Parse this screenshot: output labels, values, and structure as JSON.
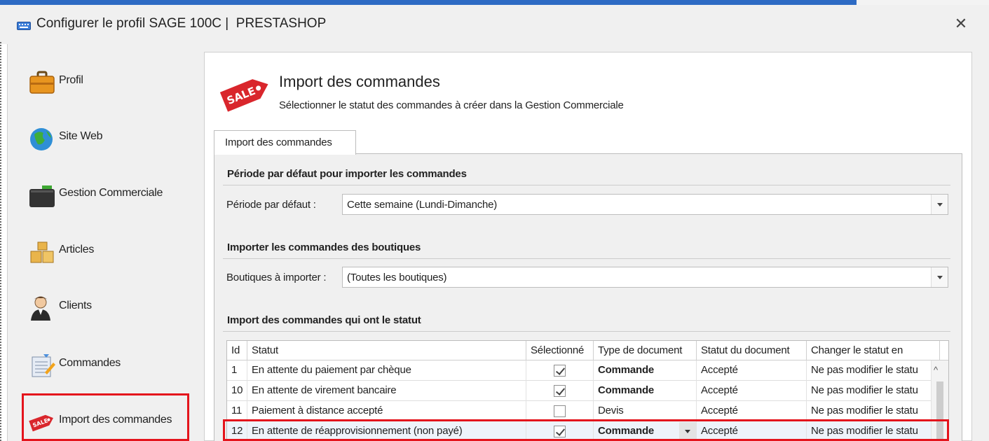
{
  "window": {
    "title": "Configurer le profil SAGE 100C |  PRESTASHOP",
    "close_glyph": "✕",
    "accent_color": "#2d6bc4"
  },
  "sidebar": {
    "items": [
      {
        "label": "Profil",
        "icon": "briefcase-icon"
      },
      {
        "label": "Site Web",
        "icon": "globe-icon"
      },
      {
        "label": "Gestion Commerciale",
        "icon": "wallet-icon"
      },
      {
        "label": "Articles",
        "icon": "boxes-icon"
      },
      {
        "label": "Clients",
        "icon": "user-icon"
      },
      {
        "label": "Commandes",
        "icon": "order-sheet-icon"
      },
      {
        "label": "Import des commandes",
        "icon": "sale-tag-icon",
        "selected": true
      }
    ],
    "highlight_color": "#e4141c"
  },
  "header": {
    "title": "Import des commandes",
    "subtitle": "Sélectionner le statut des commandes à créer dans la Gestion Commerciale",
    "icon": "sale-tag-icon",
    "icon_text": "SALE"
  },
  "tab": {
    "label": "Import des commandes"
  },
  "period_group": {
    "title": "Période par défaut pour importer les commandes",
    "label": "Période par défaut :",
    "value": "Cette semaine (Lundi-Dimanche)"
  },
  "shops_group": {
    "title": "Importer les commandes des boutiques",
    "label": "Boutiques à importer :",
    "value": "(Toutes les boutiques)"
  },
  "status_group": {
    "title": "Import des commandes qui ont le statut"
  },
  "table": {
    "columns": [
      "Id",
      "Statut",
      "Sélectionné",
      "Type de document",
      "Statut du document",
      "Changer le statut en"
    ],
    "rows": [
      {
        "id": "1",
        "statut": "En attente du paiement par chèque",
        "selected": true,
        "type": "Commande",
        "type_bold": true,
        "doc_status": "Accepté",
        "change": "Ne pas modifier le statu"
      },
      {
        "id": "10",
        "statut": "En attente de virement bancaire",
        "selected": true,
        "type": "Commande",
        "type_bold": true,
        "doc_status": "Accepté",
        "change": "Ne pas modifier le statu"
      },
      {
        "id": "11",
        "statut": "Paiement à distance accepté",
        "selected": false,
        "type": "Devis",
        "type_bold": false,
        "doc_status": "Accepté",
        "change": "Ne pas modifier le statu"
      },
      {
        "id": "12",
        "statut": "En attente de réapprovisionnement (non payé)",
        "selected": true,
        "type": "Commande",
        "type_bold": true,
        "doc_status": "Accepté",
        "change": "Ne pas modifier le statu",
        "active": true
      }
    ]
  }
}
